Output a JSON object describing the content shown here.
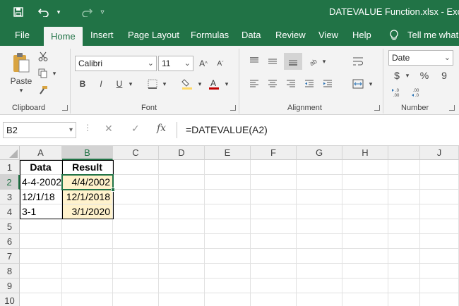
{
  "window": {
    "title": "DATEVALUE Function.xlsx  -  Excel",
    "quick_access": [
      "save-icon",
      "undo-icon",
      "undo-dropdown-icon",
      "redo-icon",
      "customize-icon"
    ]
  },
  "ribbon": {
    "tabs": [
      "File",
      "Home",
      "Insert",
      "Page Layout",
      "Formulas",
      "Data",
      "Review",
      "View",
      "Help",
      "Tell me what"
    ],
    "active_tab": "Home",
    "clipboard": {
      "paste_label": "Paste",
      "group_label": "Clipboard"
    },
    "font": {
      "name": "Calibri",
      "size": "11",
      "group_label": "Font",
      "bold": "B",
      "italic": "I",
      "underline": "U",
      "font_color": "#c00000",
      "fill_color": "#ffd966"
    },
    "alignment": {
      "group_label": "Alignment"
    },
    "number": {
      "format": "Date",
      "group_label": "Number",
      "currency": "$",
      "percent": "%",
      "comma": "9"
    }
  },
  "formula_bar": {
    "name_box": "B2",
    "fx": "fx",
    "formula": "=DATEVALUE(A2)"
  },
  "sheet": {
    "columns": [
      "A",
      "B",
      "C",
      "D",
      "E",
      "F",
      "G",
      "H",
      "J"
    ],
    "selected_column": "B",
    "rows": [
      "1",
      "2",
      "3",
      "4",
      "5",
      "6",
      "7",
      "8",
      "9",
      "10"
    ],
    "selected_row": "2",
    "cells": {
      "A1": "Data",
      "B1": "Result",
      "A2": "4-4-2002",
      "B2": "4/4/2002",
      "A3": "12/1/18",
      "B3": "12/1/2018",
      "A4": "3-1",
      "B4": "3/1/2020"
    },
    "highlight_color": "#fff2cc",
    "accent": "#217346"
  }
}
